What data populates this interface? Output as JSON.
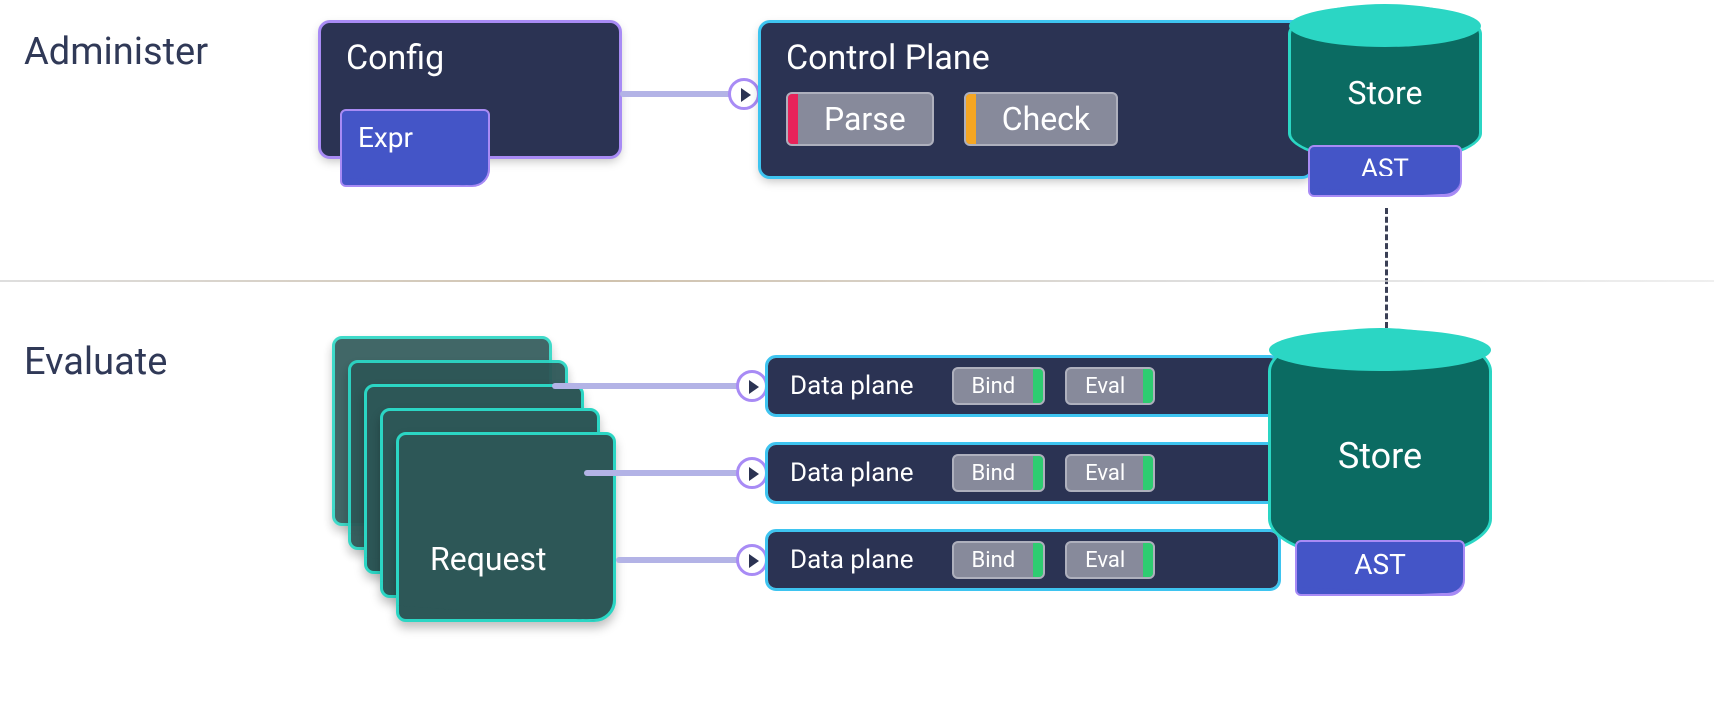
{
  "phases": {
    "administer": "Administer",
    "evaluate": "Evaluate"
  },
  "config": {
    "title": "Config",
    "expr": "Expr"
  },
  "control_plane": {
    "title": "Control Plane",
    "tasks": [
      {
        "label": "Parse",
        "stripe": "red"
      },
      {
        "label": "Check",
        "stripe": "orange"
      }
    ]
  },
  "store_top": {
    "label": "Store",
    "ast": "AST"
  },
  "store_bottom": {
    "label": "Store",
    "ast": "AST"
  },
  "request": {
    "label": "Request"
  },
  "data_planes": [
    {
      "title": "Data plane",
      "tasks": [
        {
          "label": "Bind",
          "stripe": "green"
        },
        {
          "label": "Eval",
          "stripe": "green"
        }
      ]
    },
    {
      "title": "Data plane",
      "tasks": [
        {
          "label": "Bind",
          "stripe": "green"
        },
        {
          "label": "Eval",
          "stripe": "green"
        }
      ]
    },
    {
      "title": "Data plane",
      "tasks": [
        {
          "label": "Bind",
          "stripe": "green"
        },
        {
          "label": "Eval",
          "stripe": "green"
        }
      ]
    }
  ],
  "colors": {
    "panel_bg": "#2b3353",
    "outline_purple": "#a88bf5",
    "outline_cyan": "#3ec4f0",
    "expr_bg": "#4455c7",
    "store_body": "#0b6b62",
    "store_top_fill": "#2bd6c4",
    "task_bg": "#878a9b",
    "stripe_red": "#e7235a",
    "stripe_orange": "#f5a623",
    "stripe_green": "#2ecc71",
    "connector": "#b3b3e6",
    "request_bg": "#2d5757"
  }
}
